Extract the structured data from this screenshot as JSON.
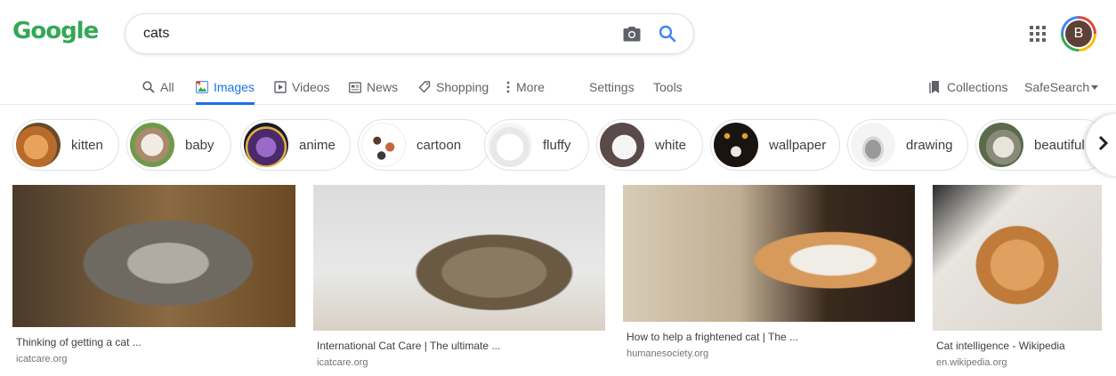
{
  "header": {
    "logo": "Google",
    "search_value": "cats",
    "avatar_initial": "B"
  },
  "nav": {
    "tabs": [
      {
        "label": "All",
        "icon": "search-icon"
      },
      {
        "label": "Images",
        "icon": "images-icon",
        "active": true
      },
      {
        "label": "Videos",
        "icon": "videos-icon"
      },
      {
        "label": "News",
        "icon": "news-icon"
      },
      {
        "label": "Shopping",
        "icon": "shopping-icon"
      },
      {
        "label": "More",
        "icon": "more-icon"
      }
    ],
    "settings": "Settings",
    "tools": "Tools",
    "collections": "Collections",
    "safesearch": "SafeSearch"
  },
  "chips": [
    {
      "label": "kitten"
    },
    {
      "label": "baby"
    },
    {
      "label": "anime"
    },
    {
      "label": "cartoon"
    },
    {
      "label": "fluffy"
    },
    {
      "label": "white"
    },
    {
      "label": "wallpaper"
    },
    {
      "label": "drawing"
    },
    {
      "label": "beautiful"
    }
  ],
  "results": [
    {
      "title": "Thinking of getting a cat ...",
      "source": "icatcare.org"
    },
    {
      "title": "International Cat Care | The ultimate ...",
      "source": "icatcare.org"
    },
    {
      "title": "How to help a frightened cat | The ...",
      "source": "humanesociety.org"
    },
    {
      "title": "Cat intelligence - Wikipedia",
      "source": "en.wikipedia.org"
    }
  ],
  "colors": {
    "accent": "#1a73e8",
    "logo": "#34a853",
    "muted": "#5f6368"
  }
}
